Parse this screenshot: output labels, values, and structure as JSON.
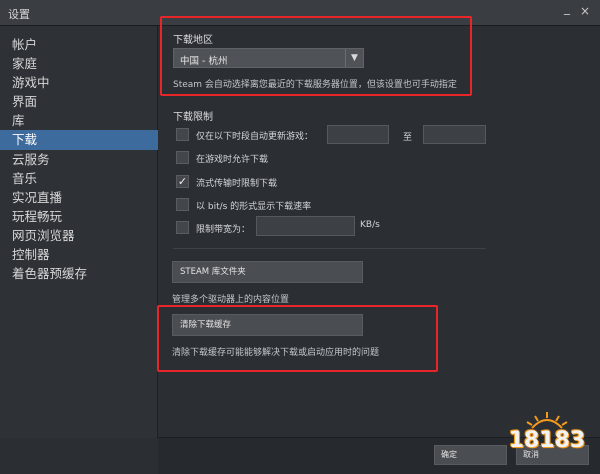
{
  "window": {
    "title": "设置",
    "minimize_glyph": "_",
    "close_glyph": "×"
  },
  "sidebar": {
    "items": [
      {
        "label": "帐户"
      },
      {
        "label": "家庭"
      },
      {
        "label": "游戏中"
      },
      {
        "label": "界面"
      },
      {
        "label": "库"
      },
      {
        "label": "下载",
        "active": true
      },
      {
        "label": "云服务"
      },
      {
        "label": "音乐"
      },
      {
        "label": "实况直播"
      },
      {
        "label": "玩程畅玩"
      },
      {
        "label": "网页浏览器"
      },
      {
        "label": "控制器"
      },
      {
        "label": "着色器预缓存"
      }
    ]
  },
  "download_region": {
    "title": "下载地区",
    "selected": "中国 - 杭州",
    "hint": "Steam 会自动选择离您最近的下载服务器位置，但该设置也可手动指定"
  },
  "download_limits": {
    "title": "下载限制",
    "options": [
      {
        "label": "仅在以下时段自动更新游戏：",
        "checked": false
      },
      {
        "label": "在游戏时允许下载",
        "checked": false
      },
      {
        "label": "流式传输时限制下载",
        "checked": true
      },
      {
        "label": "以 bit/s 的形式显示下载速率",
        "checked": false
      },
      {
        "label": "限制带宽为：",
        "checked": false
      }
    ],
    "time_separator": "至",
    "bandwidth_unit": "KB/s"
  },
  "library_folders": {
    "button_label": "STEAM 库文件夹",
    "hint": "管理多个驱动器上的内容位置"
  },
  "clear_cache": {
    "button_label": "清除下载缓存",
    "hint": "清除下载缓存可能能够解决下载或启动应用时的问题"
  },
  "footer": {
    "ok_label": "确定",
    "cancel_label": "取消"
  },
  "watermark": {
    "text": "18183"
  },
  "colors": {
    "highlight": "#e8262a",
    "active_nav": "#3e6b9d",
    "background": "#2b2e33"
  }
}
